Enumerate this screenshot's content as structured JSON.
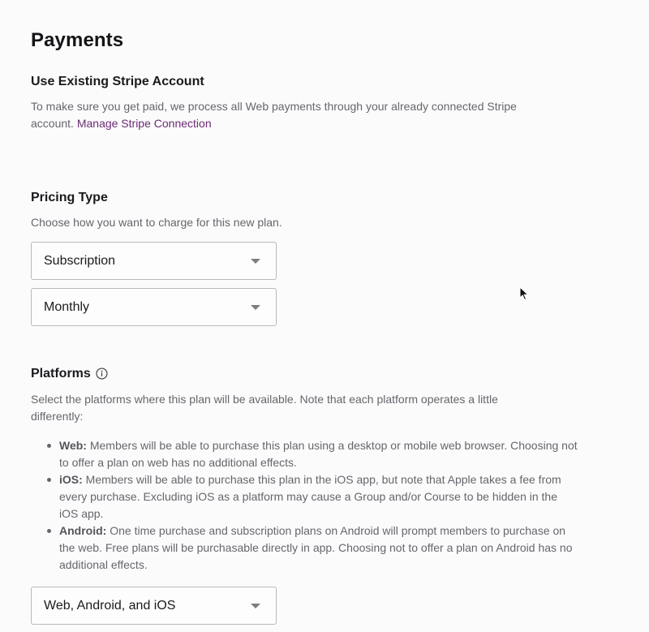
{
  "page": {
    "title": "Payments"
  },
  "stripe": {
    "heading": "Use Existing Stripe Account",
    "description": "To make sure you get paid, we process all Web payments through your already connected Stripe account.",
    "link_label": "Manage Stripe Connection"
  },
  "pricing": {
    "heading": "Pricing Type",
    "description": "Choose how you want to charge for this new plan.",
    "type_select": {
      "value": "Subscription"
    },
    "interval_select": {
      "value": "Monthly"
    }
  },
  "platforms": {
    "heading": "Platforms",
    "info_icon": "info-circle-icon",
    "description": "Select the platforms where this plan will be available. Note that each platform operates a little differently:",
    "items": [
      {
        "name": "Web:",
        "text": " Members will be able to purchase this plan using a desktop or mobile web browser. Choosing not to offer a plan on web has no additional effects."
      },
      {
        "name": "iOS:",
        "text": " Members will be able to purchase this plan in the iOS app, but note that Apple takes a fee from every purchase. Excluding iOS as a platform may cause a Group and/or Course to be hidden in the iOS app."
      },
      {
        "name": "Android:",
        "text": " One time purchase and subscription plans on Android will prompt members to purchase on the web. Free plans will be purchasable directly in app. Choosing not to offer a plan on Android has no additional effects."
      }
    ],
    "platform_select": {
      "value": "Web, Android, and iOS"
    }
  },
  "colors": {
    "link": "#6a2b74",
    "body_text": "#66656b",
    "heading": "#1a1a1d",
    "select_border": "#b9b8bd"
  }
}
